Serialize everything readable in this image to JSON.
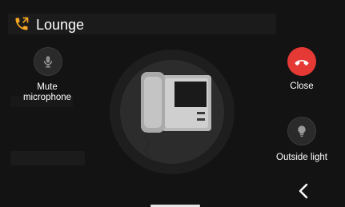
{
  "header": {
    "title": "Lounge",
    "call_icon": "incoming-call-icon"
  },
  "actions": {
    "mute": {
      "label": "Mute\nmicrophone",
      "icon": "microphone-icon"
    },
    "close": {
      "label": "Close",
      "icon": "hang-up-icon",
      "color": "#e53935"
    },
    "outside_light": {
      "label": "Outside light",
      "icon": "light-bulb-icon"
    }
  },
  "center": {
    "icon": "intercom-phone-icon"
  },
  "nav": {
    "back_icon": "chevron-left-icon"
  },
  "colors": {
    "accent": "#f5a623",
    "background": "#131313",
    "danger": "#e53935"
  }
}
